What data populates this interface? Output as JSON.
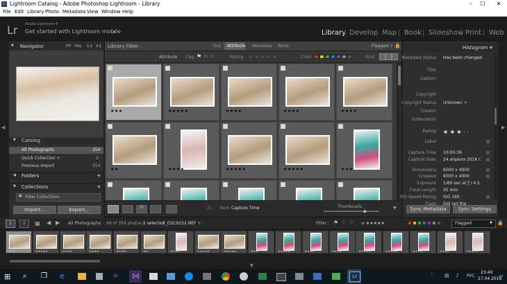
{
  "window": {
    "title": "Lightroom Catalog - Adobe Photoshop Lightroom - Library",
    "app_icon": "Lr",
    "controls": [
      "–",
      "☐",
      "✕"
    ]
  },
  "menu": [
    "File",
    "Edit",
    "Library",
    "Photo",
    "Metadata",
    "View",
    "Window",
    "Help"
  ],
  "identity": {
    "logo": "Lr",
    "product": "Adobe Lightroom 6",
    "prompt": "Get started with Lightroom mobile",
    "prompt_arrow": "▸"
  },
  "modules": [
    {
      "label": "Library",
      "active": true
    },
    {
      "label": "Develop"
    },
    {
      "label": "Map"
    },
    {
      "label": "Book"
    },
    {
      "label": "Slideshow"
    },
    {
      "label": "Print"
    },
    {
      "label": "Web"
    }
  ],
  "navigator": {
    "title": "Navigator",
    "zoom_options": [
      "FIT",
      "FILL",
      "1:1",
      "3:1"
    ],
    "collapse_arrow": "▼"
  },
  "catalog": {
    "title": "Catalog",
    "items": [
      {
        "label": "All Photographs",
        "count": "354"
      },
      {
        "label": "Quick Collection +",
        "count": "0"
      },
      {
        "label": "Previous Import",
        "count": "354"
      }
    ]
  },
  "folders": {
    "title": "Folders",
    "add": "+"
  },
  "collections": {
    "title": "Collections",
    "add": "+",
    "filter": "Filter Collections"
  },
  "left_buttons": {
    "import": "Import...",
    "export": "Export..."
  },
  "filter_bar": {
    "title": "Library Filter :",
    "tabs": [
      "Text",
      "Attribute",
      "Metadata",
      "None"
    ],
    "preset": "Flagged ÷",
    "attribute_label": "Attribute",
    "flag_label": "Flag",
    "rating_label": "Rating",
    "rating_stars": "★ ★ ★ ★ ★",
    "color_label": "Color",
    "kind_label": "Kind",
    "colors": [
      "#c0392b",
      "#d4c026",
      "#3a9e3a",
      "#3d6fb8",
      "#7d3fa0",
      "#888888",
      "#555555"
    ]
  },
  "grid": {
    "cells": [
      {
        "num": "",
        "stars": "★★★",
        "pic": "land",
        "selected": true
      },
      {
        "num": "",
        "stars": "★★★★★",
        "pic": "land"
      },
      {
        "num": "",
        "stars": "★★★★",
        "pic": "land"
      },
      {
        "num": "",
        "stars": "★★★★",
        "pic": "land"
      },
      {
        "num": "",
        "stars": "★★★★",
        "pic": "land"
      },
      {
        "num": "",
        "stars": "★★",
        "pic": "land"
      },
      {
        "num": "",
        "stars": "★★★★",
        "pic": "port"
      },
      {
        "num": "",
        "stars": "★★★★★",
        "pic": "land"
      },
      {
        "num": "",
        "stars": "★★★★★",
        "pic": "land"
      },
      {
        "num": "",
        "stars": "★★★",
        "pic": "teal"
      },
      {
        "num": "",
        "stars": "",
        "pic": "teal"
      },
      {
        "num": "",
        "stars": "",
        "pic": "teal"
      },
      {
        "num": "",
        "stars": "",
        "pic": "teal"
      },
      {
        "num": "",
        "stars": "",
        "pic": "teal"
      },
      {
        "num": "",
        "stars": "",
        "pic": "teal"
      }
    ]
  },
  "toolbar": {
    "sort_label": "Sort:",
    "sort_value": "Capture Time",
    "thumbnails_label": "Thumbnails",
    "view_icons": [
      "grid-view-icon",
      "loupe-view-icon",
      "compare-view-icon",
      "survey-view-icon",
      "people-view-icon"
    ]
  },
  "histogram": {
    "title": "Histogram",
    "arrow": "◀"
  },
  "metadata": {
    "rows": [
      {
        "label": "Metadata Status",
        "value": "Has been changed"
      },
      {
        "label": "Title",
        "value": ""
      },
      {
        "label": "Caption",
        "value": ""
      },
      {
        "label": "Copyright",
        "value": ""
      },
      {
        "label": "Copyright Status",
        "value": "Unknown ÷"
      },
      {
        "label": "Creator",
        "value": ""
      },
      {
        "label": "Sublocation",
        "value": ""
      },
      {
        "label": "Rating",
        "value": "★ ★ ★ · ·"
      },
      {
        "label": "Label",
        "value": ""
      },
      {
        "label": "Capture Time",
        "value": "10:00:36"
      },
      {
        "label": "Capture Date",
        "value": "24 апреля 2016 г."
      },
      {
        "label": "Dimensions",
        "value": "6000 x 4000"
      },
      {
        "label": "Cropped",
        "value": "6000 x 4000"
      },
      {
        "label": "Exposure",
        "value": "1/60 sec at ƒ / 4.5"
      },
      {
        "label": "Focal Length",
        "value": "35 mm"
      },
      {
        "label": "ISO Speed Rating",
        "value": "ISO 160"
      },
      {
        "label": "Flash",
        "value": "Did not fire"
      }
    ]
  },
  "right_buttons": {
    "sync_metadata": "Sync Metadata",
    "sync_settings": "Sync Settings"
  },
  "filmstrip_bar": {
    "pages": [
      "1",
      "2"
    ],
    "source": "All Photographs",
    "count_info": "98 of 354 photos /",
    "selected": "1 selected",
    "filename": "/ _DSC0232.NEF ÷",
    "filter_label": "Filter :",
    "stars": "≥ ★★★★★",
    "preset": "Flagged"
  },
  "filmstrip": [
    {
      "pic": "land",
      "stars": "★★★",
      "selected": true
    },
    {
      "pic": "land",
      "stars": "★★★★★"
    },
    {
      "pic": "land",
      "stars": "★★★★"
    },
    {
      "pic": "land",
      "stars": "★★★★"
    },
    {
      "pic": "land",
      "stars": "★★★★"
    },
    {
      "pic": "land",
      "stars": "★★"
    },
    {
      "pic": "port",
      "stars": "★★★★"
    },
    {
      "pic": "land",
      "stars": "★★★★★"
    },
    {
      "pic": "land",
      "stars": "★★★★★"
    },
    {
      "pic": "teal",
      "stars": "★★★"
    },
    {
      "pic": "teal",
      "stars": "★★★★★"
    },
    {
      "pic": "teal",
      "stars": "★★★★"
    },
    {
      "pic": "teal",
      "stars": "★★★★"
    },
    {
      "pic": "teal",
      "stars": "★★★★★"
    },
    {
      "pic": "teal",
      "stars": "★★★★★"
    },
    {
      "pic": "teal",
      "stars": "★★★★"
    },
    {
      "pic": "port",
      "stars": "★★★★"
    },
    {
      "pic": "port",
      "stars": "★★★★★"
    }
  ],
  "taskbar": {
    "clock_time": "23:40",
    "clock_date": "27.04.2016",
    "lang": "РУС",
    "icons": [
      "start-icon",
      "search-icon",
      "task-view-icon",
      "edge-icon",
      "explorer-icon",
      "store-icon",
      "link-icon",
      "visual-studio-icon",
      "paint-icon",
      "app-icon",
      "skype-icon",
      "chrome-icon",
      "sound-icon",
      "image-icon",
      "terminal-icon",
      "greenapp-icon",
      "lightroom-icon"
    ]
  }
}
